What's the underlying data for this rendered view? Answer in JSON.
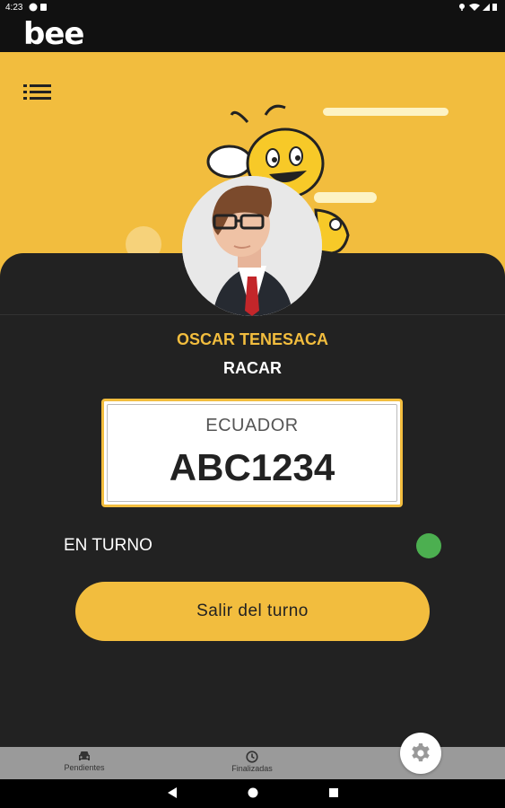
{
  "status_bar": {
    "time": "4:23"
  },
  "app": {
    "logo_text": "bee"
  },
  "driver": {
    "name": "OSCAR TENESACA",
    "company": "RACAR"
  },
  "plate": {
    "country": "ECUADOR",
    "number": "ABC1234"
  },
  "shift": {
    "status_label": "EN TURNO",
    "exit_button_label": "Salir del turno"
  },
  "bottom_nav": {
    "items": [
      {
        "label": "Pendientes",
        "icon": "car-icon"
      },
      {
        "label": "Finalizadas",
        "icon": "clock-icon"
      }
    ]
  },
  "fab_icon": "gear-icon",
  "colors": {
    "brand_yellow": "#f2bd3e",
    "status_green": "#4caf50",
    "panel_dark": "#222222"
  }
}
